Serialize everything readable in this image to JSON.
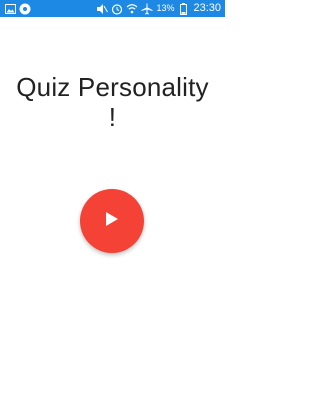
{
  "status_bar": {
    "battery_percent": "13%",
    "time": "23:30",
    "icons_left": [
      "photo-icon",
      "settings-app-icon"
    ],
    "icons_right": [
      "mute-icon",
      "alarm-icon",
      "wifi-icon",
      "airplane-icon",
      "battery-icon"
    ],
    "background_color": "#1e88e5"
  },
  "main": {
    "title_line1": "Quiz Personality",
    "title_line2": "!",
    "play_button_icon": "play-icon",
    "play_button_color": "#f44336"
  }
}
